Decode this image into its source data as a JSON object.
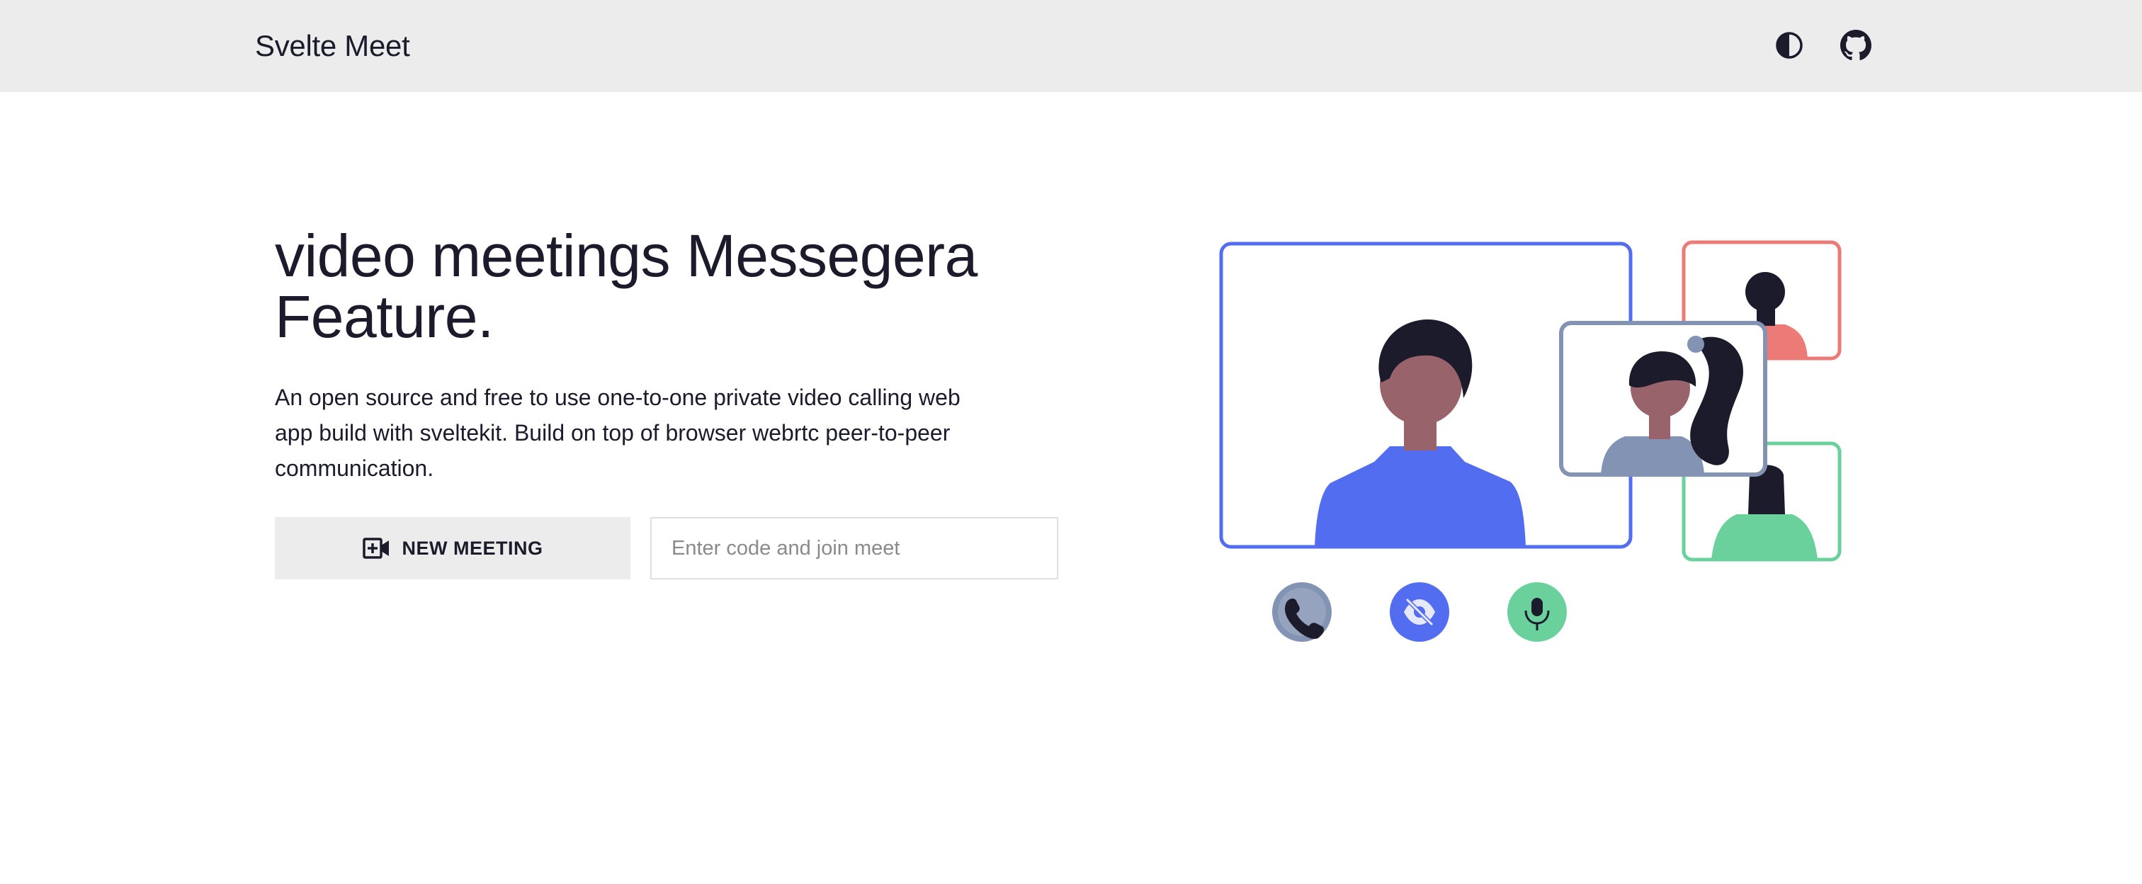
{
  "header": {
    "brand": "Svelte Meet",
    "theme_toggle_icon": "half-circle-contrast-icon",
    "github_icon": "github-icon"
  },
  "hero": {
    "headline_line1": "video meetings Messegera",
    "headline_line2": "Feature.",
    "description": "An open source and free to use one-to-one private video calling web app build with sveltekit. Build on top of browser webrtc peer-to-peer communication.",
    "new_meeting_label": "NEW MEETING",
    "new_meeting_icon": "video-plus-icon",
    "join_placeholder": "Enter code and join meet",
    "join_value": ""
  },
  "illustration": {
    "call_controls": [
      {
        "icon": "phone-icon",
        "color": "#8393b3"
      },
      {
        "icon": "eye-off-icon",
        "color": "#536df0"
      },
      {
        "icon": "microphone-icon",
        "color": "#6bd19c"
      }
    ]
  },
  "colors": {
    "navbar_bg": "#ececec",
    "text": "#1b1b2c",
    "accent_blue": "#536df0",
    "accent_red": "#ec7b78",
    "accent_green": "#6bd19c",
    "accent_slate": "#8393b3"
  }
}
